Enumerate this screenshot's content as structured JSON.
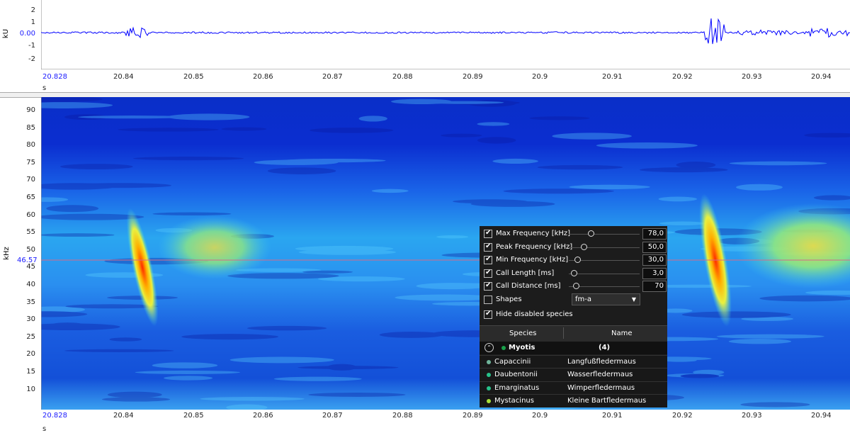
{
  "waveform": {
    "unit_label": "kU",
    "y_ticks": [
      "2",
      "1",
      "0.00",
      "-1",
      "-2"
    ],
    "x_start": "20.828",
    "x_ticks": [
      "20.84",
      "20.85",
      "20.86",
      "20.87",
      "20.88",
      "20.89",
      "20.9",
      "20.91",
      "20.92",
      "20.93",
      "20.94"
    ],
    "x_unit": "s"
  },
  "spectrogram": {
    "unit_label": "kHz",
    "y_ticks": [
      "90",
      "85",
      "80",
      "75",
      "70",
      "65",
      "60",
      "55",
      "50",
      "45",
      "40",
      "35",
      "30",
      "25",
      "20",
      "15",
      "10"
    ],
    "cursor_value": "46.57",
    "x_start": "20.828",
    "x_ticks": [
      "20.84",
      "20.85",
      "20.86",
      "20.87",
      "20.88",
      "20.89",
      "20.9",
      "20.91",
      "20.92",
      "20.93",
      "20.94"
    ],
    "x_unit": "s"
  },
  "panel": {
    "params": [
      {
        "label": "Max Frequency [kHz]",
        "value": "78,0",
        "checked": true
      },
      {
        "label": "Peak Frequency [kHz]",
        "value": "50,0",
        "checked": true
      },
      {
        "label": "Min Frequency [kHz]",
        "value": "30,0",
        "checked": true
      },
      {
        "label": "Call Length [ms]",
        "value": "3,0",
        "checked": true
      },
      {
        "label": "Call Distance [ms]",
        "value": "70",
        "checked": true
      }
    ],
    "shapes_label": "Shapes",
    "shapes_value": "fm-a",
    "hide_label": "Hide disabled species",
    "col_species": "Species",
    "col_name": "Name",
    "group_name": "Myotis",
    "group_count": "(4)",
    "species": [
      {
        "species": "Capaccinii",
        "name": "Langfußfledermaus",
        "color": "#6fb59a"
      },
      {
        "species": "Daubentonii",
        "name": "Wasserfledermaus",
        "color": "#27c28a"
      },
      {
        "species": "Emarginatus",
        "name": "Wimperfledermaus",
        "color": "#27c28a"
      },
      {
        "species": "Mystacinus",
        "name": "Kleine Bartfledermaus",
        "color": "#a8e03a"
      }
    ]
  },
  "colors": {
    "waveform": "#0000ff",
    "spectro_bg": "#1e4fd6",
    "cursor": "#d46a8a"
  }
}
